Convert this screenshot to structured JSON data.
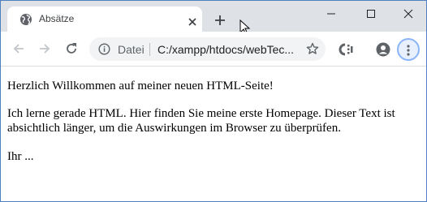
{
  "tab": {
    "title": "Absätze",
    "favicon": "globe-icon"
  },
  "window_controls": [
    "minimize-icon",
    "maximize-icon",
    "close-icon"
  ],
  "toolbar": {
    "back_icon": "arrow-left-icon",
    "forward_icon": "arrow-right-icon",
    "reload_icon": "reload-icon",
    "omnibox": {
      "scheme_label": "Datei",
      "url": "C:/xampp/htdocs/webTec..."
    },
    "bookmark_icon": "star-icon",
    "extension_icon": "extension-icon",
    "profile_icon": "profile-icon",
    "menu_icon": "kebab-menu-icon"
  },
  "page": {
    "paragraphs": [
      "Herzlich Willkommen auf meiner neuen HTML-Seite!",
      "Ich lerne gerade HTML. Hier finden Sie meine erste Homepage. Dieser Text ist absichtlich länger, um die Auswirkungen im Browser zu überprüfen.",
      "Ihr ..."
    ]
  },
  "colors": {
    "tabstrip": "#dee1e6",
    "omnibox": "#f1f3f4",
    "window_border": "#4f7fbf",
    "menu_highlight": "#8ab4f8"
  }
}
